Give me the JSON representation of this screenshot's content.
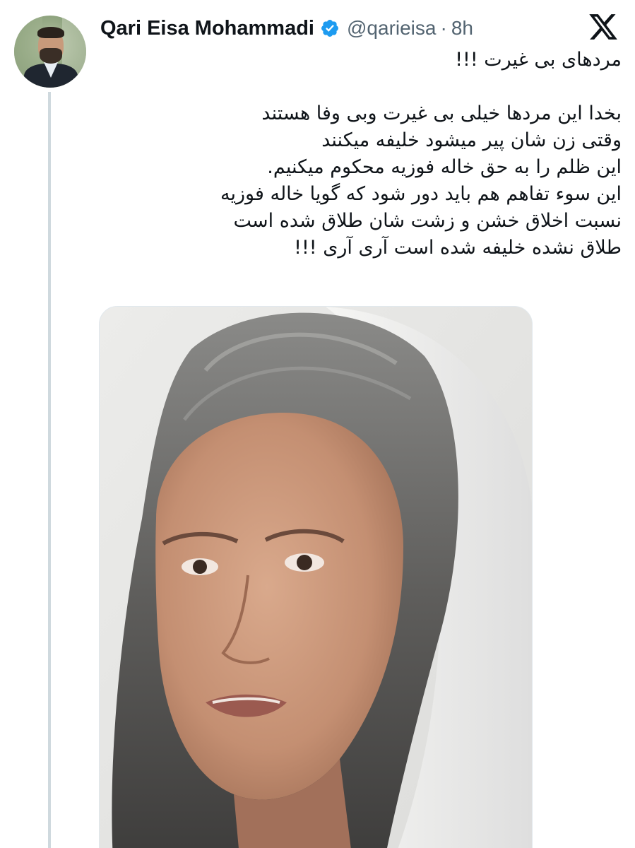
{
  "author": {
    "name": "Qari Eisa Mohammadi",
    "handle": "@qarieisa",
    "separator": "·",
    "time": "8h",
    "verified": true
  },
  "icons": {
    "verified": "verified-badge-icon",
    "platform": "x-logo-icon"
  },
  "tweet": {
    "lines": [
      "مردهای بی غیرت !!!",
      "",
      "بخدا این مردها خیلی بی غیرت وبی وفا هستند",
      "وقتی زن شان پیر میشود خلیفه میکنند",
      "این ظلم را به حق خاله فوزیه محکوم میکنیم.",
      "این سوء تفاهم هم باید دور شود که گویا خاله فوزیه",
      "نسبت اخلاق خشن و زشت شان طلاق شده است",
      "طلاق نشده خلیفه شده است آری آری !!!"
    ]
  },
  "colors": {
    "verified": "#1d9bf0",
    "text": "#0f1419",
    "secondary": "#536471",
    "thread": "#cfd9de"
  }
}
